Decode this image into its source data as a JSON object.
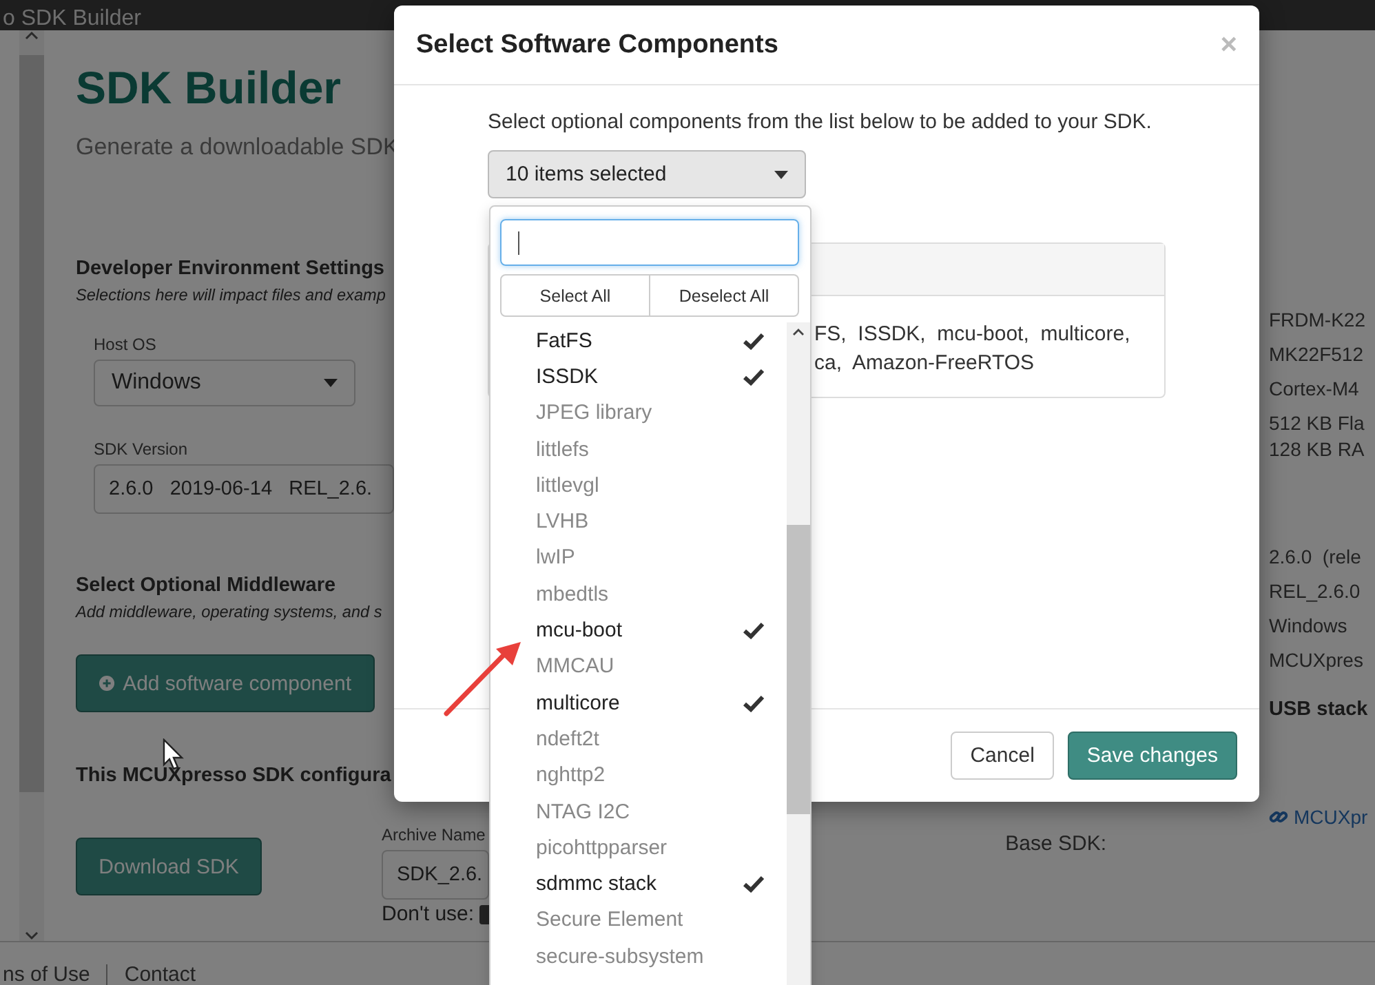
{
  "app_bar": {
    "title": "o SDK Builder"
  },
  "page": {
    "heading": "SDK Builder",
    "subtitle": "Generate a downloadable SDK",
    "developer_settings": {
      "title": "Developer Environment Settings",
      "note": "Selections here will impact files and examp",
      "host_os": {
        "label": "Host OS",
        "value": "Windows"
      },
      "sdk_version": {
        "label": "SDK Version",
        "value": "2.6.0   2019-06-14   REL_2.6."
      }
    },
    "middleware": {
      "title": "Select Optional Middleware",
      "note": "Add middleware, operating systems, and s",
      "add_button": "Add software component"
    },
    "configuration": {
      "title": "This MCUXpresso SDK configura",
      "download_button": "Download SDK",
      "archive_name": {
        "label": "Archive Name",
        "value": "SDK_2.6."
      },
      "dont_use_label": "Don't use:",
      "base_sdk_label": "Base SDK:"
    },
    "summary": {
      "board": [
        "FRDM-K22",
        "MK22F512",
        "Cortex-M4",
        "512 KB Fla",
        "128 KB RA"
      ],
      "sdk": [
        "2.6.0  (rele",
        "REL_2.6.0",
        "Windows",
        "MCUXpres"
      ],
      "usb_stack": "USB stack",
      "base_sdk_link": "MCUXpr"
    },
    "footer_links": [
      "ns of Use",
      "Contact"
    ]
  },
  "modal": {
    "title": "Select Software Components",
    "close": "×",
    "intro": "Select optional components from the list below to be added to your SDK.",
    "dropdown": {
      "value": "10 items selected",
      "select_all": "Select All",
      "deselect_all": "Deselect All",
      "items": [
        {
          "label": "FatFS",
          "checked": true
        },
        {
          "label": "ISSDK",
          "checked": true
        },
        {
          "label": "JPEG library",
          "checked": false
        },
        {
          "label": "littlefs",
          "checked": false
        },
        {
          "label": "littlevgl",
          "checked": false
        },
        {
          "label": "LVHB",
          "checked": false
        },
        {
          "label": "lwIP",
          "checked": false
        },
        {
          "label": "mbedtls",
          "checked": false
        },
        {
          "label": "mcu-boot",
          "checked": true
        },
        {
          "label": "MMCAU",
          "checked": false
        },
        {
          "label": "multicore",
          "checked": true
        },
        {
          "label": "ndeft2t",
          "checked": false
        },
        {
          "label": "nghttp2",
          "checked": false
        },
        {
          "label": "NTAG I2C",
          "checked": false
        },
        {
          "label": "picohttpparser",
          "checked": false
        },
        {
          "label": "sdmmc stack",
          "checked": true
        },
        {
          "label": "Secure Element",
          "checked": false
        },
        {
          "label": "secure-subsystem",
          "checked": false
        }
      ]
    },
    "selected_summary": [
      "FS,  ISSDK,  mcu-boot,  multicore,",
      "ca,  Amazon-FreeRTOS"
    ],
    "buttons": [
      {
        "label": "Cancel",
        "kind": "default"
      },
      {
        "label": "Save changes",
        "kind": "primary"
      }
    ]
  }
}
